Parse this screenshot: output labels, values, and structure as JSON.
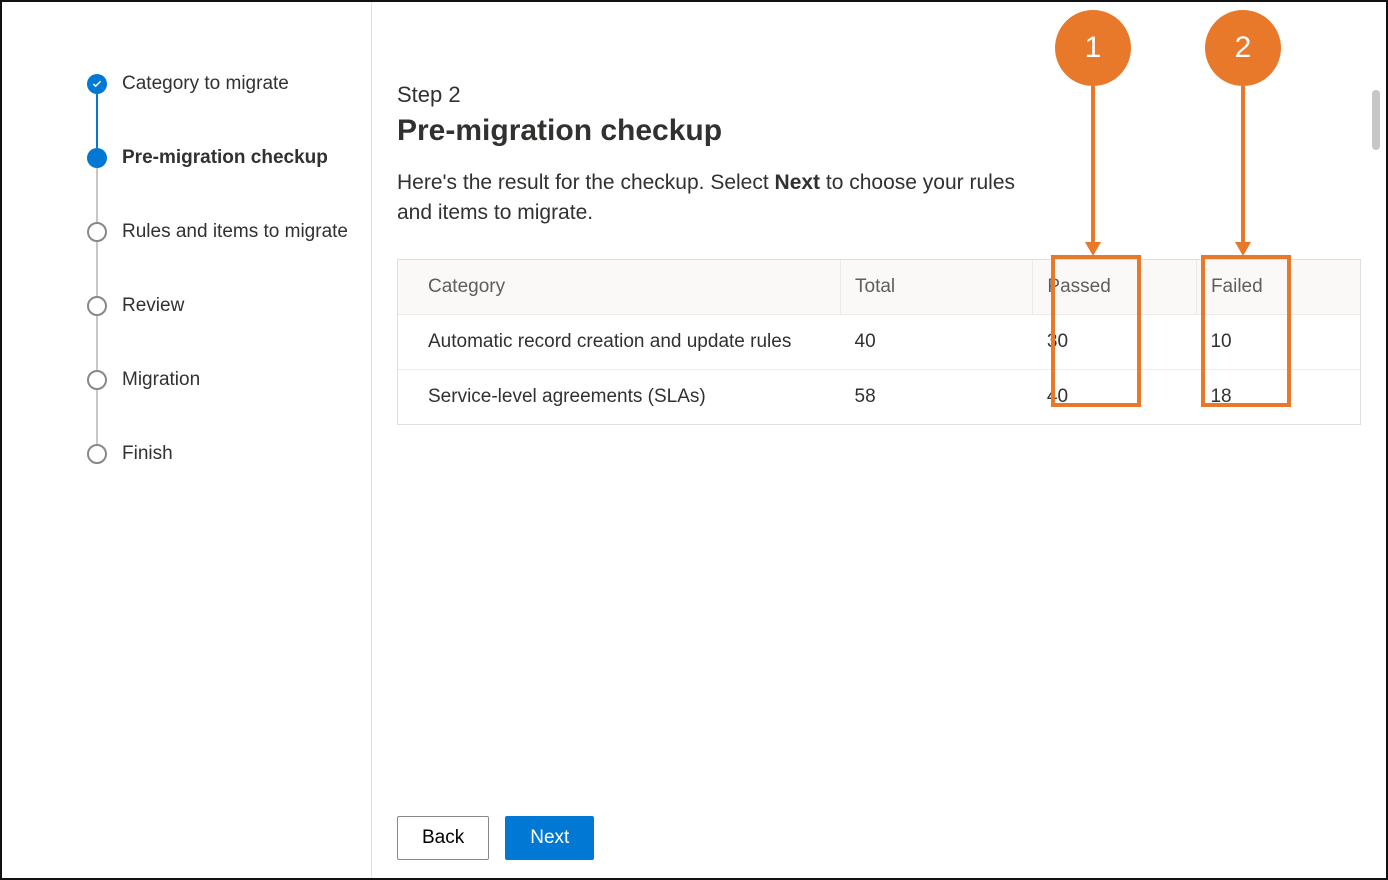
{
  "sidebar": {
    "steps": [
      {
        "label": "Category to migrate",
        "state": "done"
      },
      {
        "label": "Pre-migration checkup",
        "state": "current"
      },
      {
        "label": "Rules and items to migrate",
        "state": "pending"
      },
      {
        "label": "Review",
        "state": "pending"
      },
      {
        "label": "Migration",
        "state": "pending"
      },
      {
        "label": "Finish",
        "state": "pending"
      }
    ]
  },
  "main": {
    "kicker": "Step 2",
    "title": "Pre-migration checkup",
    "intro_pre": "Here's the result for the checkup. Select ",
    "intro_bold": "Next",
    "intro_post": " to choose your rules and items to migrate.",
    "table": {
      "headers": {
        "category": "Category",
        "total": "Total",
        "passed": "Passed",
        "failed": "Failed"
      },
      "rows": [
        {
          "category": "Automatic record creation and update rules",
          "total": "40",
          "passed": "30",
          "failed": "10"
        },
        {
          "category": "Service-level agreements (SLAs)",
          "total": "58",
          "passed": "40",
          "failed": "18"
        }
      ]
    }
  },
  "footer": {
    "back": "Back",
    "next": "Next"
  },
  "annotations": {
    "callouts": [
      {
        "label": "1"
      },
      {
        "label": "2"
      }
    ]
  }
}
